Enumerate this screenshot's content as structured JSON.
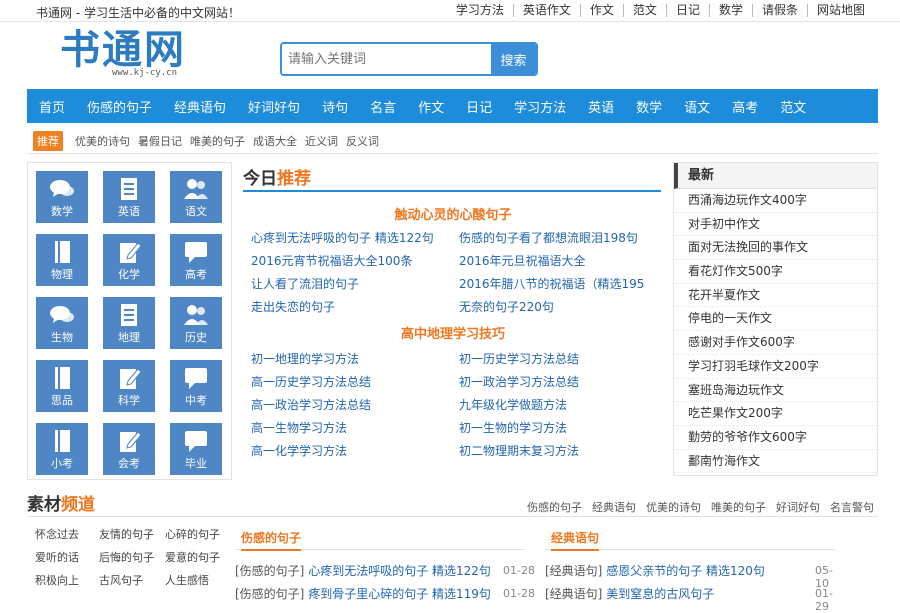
{
  "top": {
    "slogan": "书通网 - 学习生活中必备的中文网站！",
    "links": [
      "学习方法",
      "英语作文",
      "作文",
      "范文",
      "日记",
      "数学",
      "请假条",
      "网站地图"
    ]
  },
  "logo": {
    "name": "书通网",
    "domain": "www.kj-cy.cn"
  },
  "search": {
    "placeholder": "请输入关键词",
    "button": "搜索"
  },
  "nav": [
    "首页",
    "伤感的句子",
    "经典语句",
    "好词好句",
    "诗句",
    "名言",
    "作文",
    "日记",
    "学习方法",
    "英语",
    "数学",
    "语文",
    "高考",
    "范文"
  ],
  "recommend": {
    "label": "推荐",
    "items": [
      "优美的诗句",
      "暑假日记",
      "唯美的句子",
      "成语大全",
      "近义词",
      "反义词"
    ]
  },
  "subjects": [
    {
      "label": "数学",
      "icon": "chat-bubbles-icon"
    },
    {
      "label": "英语",
      "icon": "document-icon"
    },
    {
      "label": "语文",
      "icon": "people-icon"
    },
    {
      "label": "物理",
      "icon": "book-icon"
    },
    {
      "label": "化学",
      "icon": "edit-icon"
    },
    {
      "label": "高考",
      "icon": "speech-icon"
    },
    {
      "label": "生物",
      "icon": "chat-bubbles-icon"
    },
    {
      "label": "地理",
      "icon": "document-icon"
    },
    {
      "label": "历史",
      "icon": "people-icon"
    },
    {
      "label": "思品",
      "icon": "book-icon"
    },
    {
      "label": "科学",
      "icon": "edit-icon"
    },
    {
      "label": "中考",
      "icon": "speech-icon"
    },
    {
      "label": "小考",
      "icon": "book-icon"
    },
    {
      "label": "会考",
      "icon": "edit-icon"
    },
    {
      "label": "毕业",
      "icon": "speech-icon"
    }
  ],
  "today": {
    "title_plain": "今日",
    "title_highlight": "推荐",
    "section1": {
      "heading": "触动心灵的心酸句子",
      "links": [
        "心疼到无法呼吸的句子 精选122句",
        "伤感的句子看了都想流眼泪198句",
        "2016元宵节祝福语大全100条",
        "2016年元旦祝福语大全",
        "让人看了流泪的句子",
        "2016年腊八节的祝福语（精选195",
        "走出失恋的句子",
        "无奈的句子220句"
      ]
    },
    "section2": {
      "heading": "高中地理学习技巧",
      "links": [
        "初一地理的学习方法",
        "初一历史学习方法总结",
        "高一历史学习方法总结",
        "初一政治学习方法总结",
        "高一政治学习方法总结",
        "九年级化学做题方法",
        "高一生物学习方法",
        "初一生物的学习方法",
        "高一化学学习方法",
        "初二物理期末复习方法"
      ]
    }
  },
  "latest": {
    "heading": "最新",
    "items": [
      "西涌海边玩作文400字",
      "对手初中作文",
      "面对无法挽回的事作文",
      "看花灯作文500字",
      "花开半夏作文",
      "停电的一天作文",
      "感谢对手作文600字",
      "学习打羽毛球作文200字",
      "塞班岛海边玩作文",
      "吃芒果作文200字",
      "勤劳的爷爷作文600字",
      "鄱南竹海作文"
    ]
  },
  "material": {
    "title_plain": "素材",
    "title_highlight": "频道",
    "tabs": [
      "伤感的句子",
      "经典语句",
      "优美的诗句",
      "唯美的句子",
      "好词好句",
      "名言警句"
    ],
    "categories": [
      "怀念过去",
      "友情的句子",
      "心碎的句子",
      "爱听的话",
      "后悔的句子",
      "爱意的句子",
      "积极向上",
      "古风句子",
      "人生感悟"
    ]
  },
  "panels": [
    {
      "heading": "伤感的句子",
      "rows": [
        {
          "prefix": "[伤感的句子]",
          "title": "心疼到无法呼吸的句子 精选122句",
          "date": "01-28"
        },
        {
          "prefix": "[伤感的句子]",
          "title": "疼到骨子里心碎的句子 精选119句",
          "date": "01-28"
        }
      ]
    },
    {
      "heading": "经典语句",
      "rows": [
        {
          "prefix": "[经典语句]",
          "title": "感恩父亲节的句子 精选120句",
          "date": "05-10"
        },
        {
          "prefix": "[经典语句]",
          "title": "美到窒息的古风句子",
          "date": "01-29"
        }
      ]
    }
  ],
  "colors": {
    "nav": "#1d8cda",
    "accent": "#f07820",
    "tile": "#4f86c6",
    "link": "#2365b0"
  }
}
